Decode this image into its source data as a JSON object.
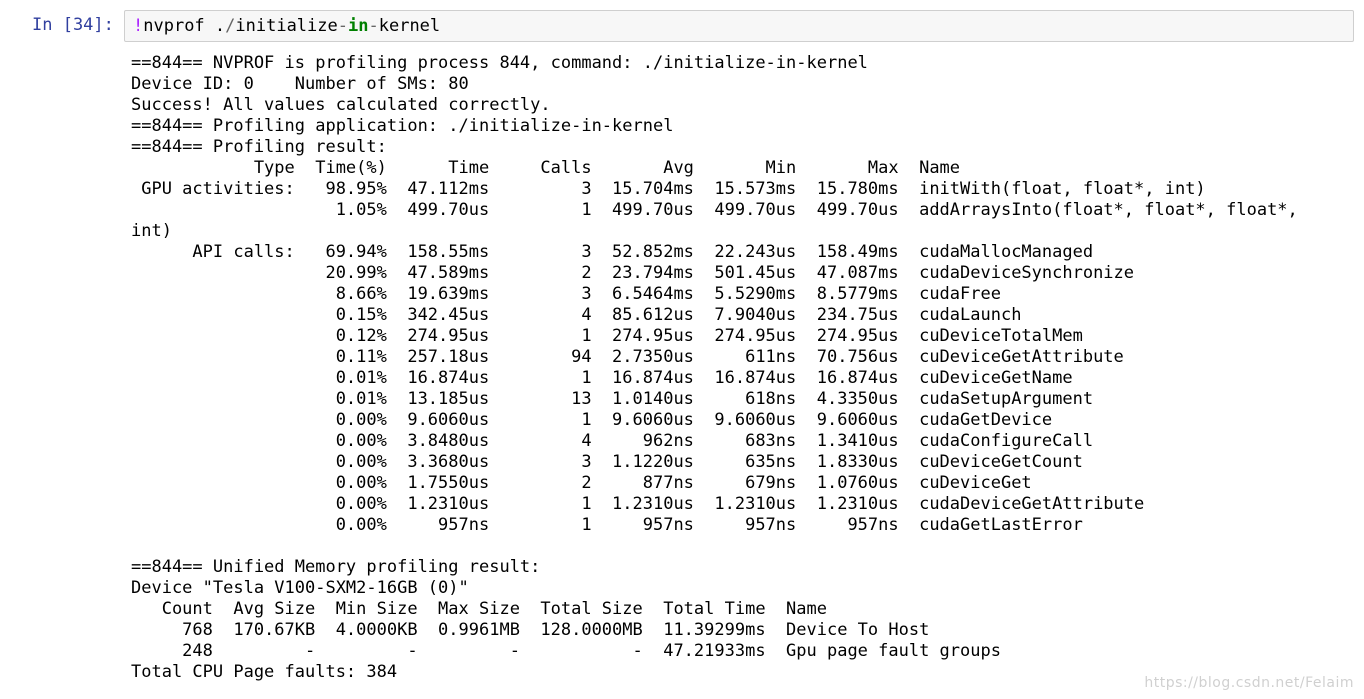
{
  "cell": {
    "prompt": "In [34]:",
    "command": {
      "bang": "!",
      "part1": "nvprof .",
      "slash": "/",
      "part2": "initialize",
      "dash1": "-",
      "kw": "in",
      "dash2": "-",
      "part3": "kernel"
    }
  },
  "output": {
    "lines": [
      "==844== NVPROF is profiling process 844, command: ./initialize-in-kernel",
      "Device ID: 0    Number of SMs: 80",
      "Success! All values calculated correctly.",
      "==844== Profiling application: ./initialize-in-kernel",
      "==844== Profiling result:",
      "            Type  Time(%)      Time     Calls       Avg       Min       Max  Name",
      " GPU activities:   98.95%  47.112ms         3  15.704ms  15.573ms  15.780ms  initWith(float, float*, int)",
      "                    1.05%  499.70us         1  499.70us  499.70us  499.70us  addArraysInto(float*, float*, float*,",
      "int)",
      "      API calls:   69.94%  158.55ms         3  52.852ms  22.243us  158.49ms  cudaMallocManaged",
      "                   20.99%  47.589ms         2  23.794ms  501.45us  47.087ms  cudaDeviceSynchronize",
      "                    8.66%  19.639ms         3  6.5464ms  5.5290ms  8.5779ms  cudaFree",
      "                    0.15%  342.45us         4  85.612us  7.9040us  234.75us  cudaLaunch",
      "                    0.12%  274.95us         1  274.95us  274.95us  274.95us  cuDeviceTotalMem",
      "                    0.11%  257.18us        94  2.7350us     611ns  70.756us  cuDeviceGetAttribute",
      "                    0.01%  16.874us         1  16.874us  16.874us  16.874us  cuDeviceGetName",
      "                    0.01%  13.185us        13  1.0140us     618ns  4.3350us  cudaSetupArgument",
      "                    0.00%  9.6060us         1  9.6060us  9.6060us  9.6060us  cudaGetDevice",
      "                    0.00%  3.8480us         4     962ns     683ns  1.3410us  cudaConfigureCall",
      "                    0.00%  3.3680us         3  1.1220us     635ns  1.8330us  cuDeviceGetCount",
      "                    0.00%  1.7550us         2     877ns     679ns  1.0760us  cuDeviceGet",
      "                    0.00%  1.2310us         1  1.2310us  1.2310us  1.2310us  cudaDeviceGetAttribute",
      "                    0.00%     957ns         1     957ns     957ns     957ns  cudaGetLastError",
      "",
      "==844== Unified Memory profiling result:",
      "Device \"Tesla V100-SXM2-16GB (0)\"",
      "   Count  Avg Size  Min Size  Max Size  Total Size  Total Time  Name",
      "     768  170.67KB  4.0000KB  0.9961MB  128.0000MB  11.39299ms  Device To Host",
      "     248         -         -         -           -  47.21933ms  Gpu page fault groups",
      "Total CPU Page faults: 384"
    ]
  },
  "watermark": "https://blog.csdn.net/Felaim"
}
